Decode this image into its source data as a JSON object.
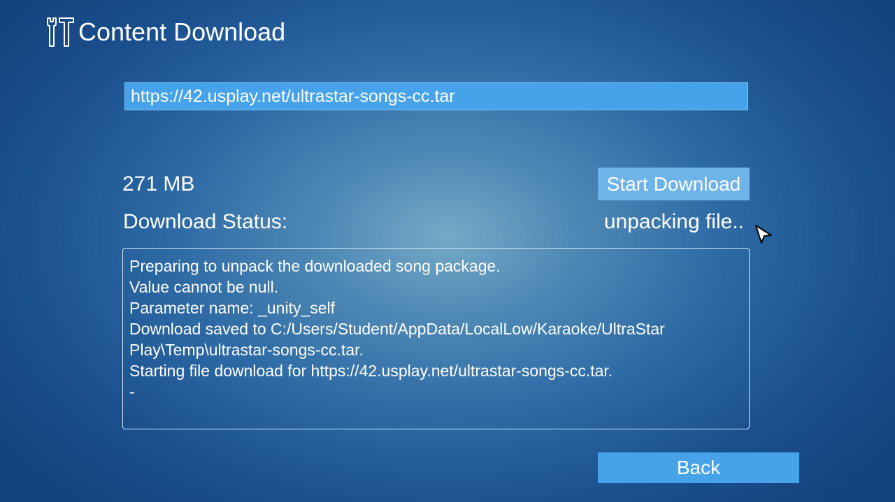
{
  "header": {
    "icon": "tools-icon",
    "title": "Content Download"
  },
  "url_input": {
    "value": "https://42.usplay.net/ultrastar-songs-cc.tar"
  },
  "download": {
    "size_label": "271 MB",
    "start_button_label": "Start Download",
    "status_label": "Download Status:",
    "status_value": "unpacking file.."
  },
  "log": {
    "lines": [
      "Preparing to unpack the downloaded song package.",
      "Value cannot be null.",
      "Parameter name: _unity_self",
      "Download saved to C:/Users/Student/AppData/LocalLow/Karaoke/UltraStar",
      "Play\\Temp\\ultrastar-songs-cc.tar.",
      "Starting file download for https://42.usplay.net/ultrastar-songs-cc.tar.",
      "-"
    ]
  },
  "footer": {
    "back_button_label": "Back"
  },
  "colors": {
    "accent": "#46a3ea",
    "start_button": "#6fb4e9",
    "background_center": "#76a9c6",
    "background_edge": "#14447f"
  }
}
